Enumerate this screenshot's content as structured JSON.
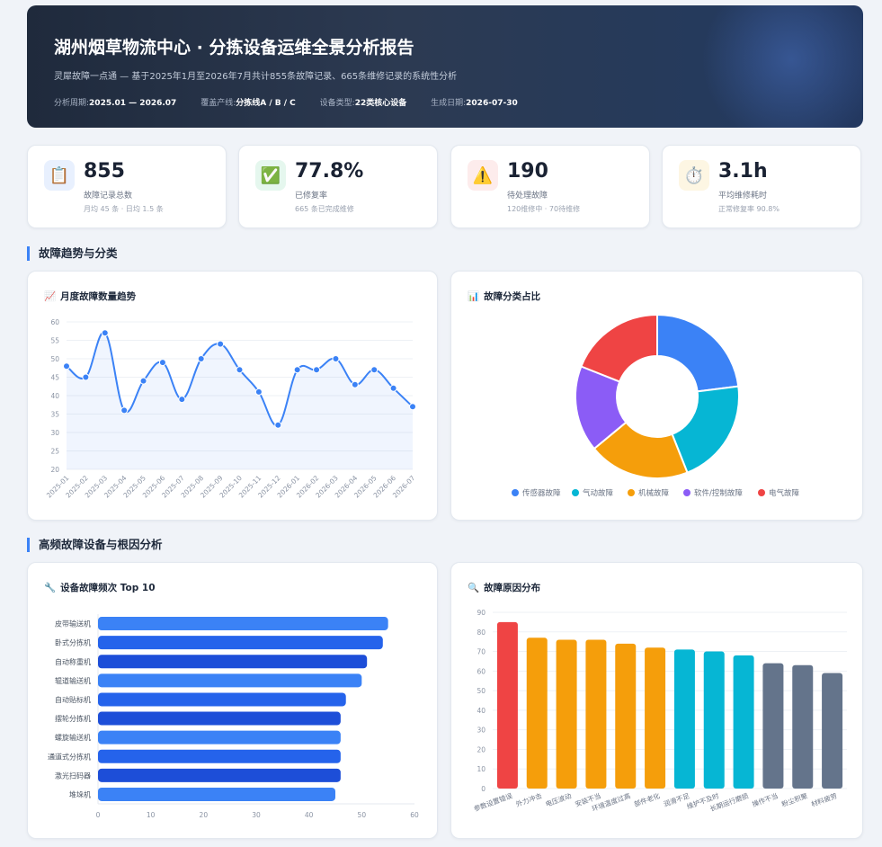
{
  "header": {
    "title": "湖州烟草物流中心 · 分拣设备运维全景分析报告",
    "subtitle": "灵犀故障一点通 — 基于2025年1月至2026年7月共计855条故障记录、665条维修记录的系统性分析",
    "meta": [
      {
        "label": "分析周期:",
        "value": "2025.01 — 2026.07"
      },
      {
        "label": "覆盖产线:",
        "value": "分拣线A / B / C"
      },
      {
        "label": "设备类型:",
        "value": "22类核心设备"
      },
      {
        "label": "生成日期:",
        "value": "2026-07-30"
      }
    ]
  },
  "kpis": [
    {
      "icon": "clipboard-icon",
      "glyph": "📋",
      "bg": "#e8f0fe",
      "value": "855",
      "label": "故障记录总数",
      "detail": "月均 45 条 · 日均 1.5 条"
    },
    {
      "icon": "check-icon",
      "glyph": "✅",
      "bg": "#e5f7ee",
      "value": "77.8%",
      "label": "已修复率",
      "detail": "665 条已完成维修"
    },
    {
      "icon": "warning-icon",
      "glyph": "⚠️",
      "bg": "#fdecec",
      "value": "190",
      "label": "待处理故障",
      "detail": "120维修中 · 70待维修"
    },
    {
      "icon": "stopwatch-icon",
      "glyph": "⏱️",
      "bg": "#fdf6e3",
      "value": "3.1h",
      "label": "平均维修耗时",
      "detail": "正常修复率 90.8%"
    }
  ],
  "sections": {
    "trend": "故障趋势与分类",
    "root": "高频故障设备与根因分析"
  },
  "cards": {
    "monthly": {
      "icon": "chart-up-icon",
      "glyph": "📈",
      "title": "月度故障数量趋势"
    },
    "category": {
      "icon": "bar-chart-icon",
      "glyph": "📊",
      "title": "故障分类占比"
    },
    "equipment": {
      "icon": "wrench-icon",
      "glyph": "🔧",
      "title": "设备故障频次 Top 10"
    },
    "cause": {
      "icon": "magnifier-icon",
      "glyph": "🔍",
      "title": "故障原因分布"
    }
  },
  "colors": {
    "blue": "#3b82f6",
    "cyan": "#06b6d4",
    "orange": "#f59e0b",
    "purple": "#8b5cf6",
    "red": "#ef4444",
    "slate": "#64748b",
    "navy": "#1d4ed8"
  },
  "chart_data": [
    {
      "id": "monthly",
      "type": "line",
      "x": [
        "2025-01",
        "2025-02",
        "2025-03",
        "2025-04",
        "2025-05",
        "2025-06",
        "2025-07",
        "2025-08",
        "2025-09",
        "2025-10",
        "2025-11",
        "2025-12",
        "2026-01",
        "2026-02",
        "2026-03",
        "2026-04",
        "2026-05",
        "2026-06",
        "2026-07"
      ],
      "values": [
        48,
        45,
        57,
        36,
        44,
        49,
        39,
        50,
        54,
        47,
        41,
        32,
        47,
        47,
        50,
        43,
        47,
        42,
        37
      ],
      "ylim": [
        20,
        60
      ],
      "yticks": [
        20,
        25,
        30,
        35,
        40,
        45,
        50,
        55,
        60
      ],
      "grid": true,
      "color": "#3b82f6"
    },
    {
      "id": "category",
      "type": "pie",
      "donut": true,
      "labels": [
        "传感器故障",
        "气动故障",
        "机械故障",
        "软件/控制故障",
        "电气故障"
      ],
      "values": [
        23,
        21,
        20,
        17,
        19
      ],
      "colors": [
        "#3b82f6",
        "#06b6d4",
        "#f59e0b",
        "#8b5cf6",
        "#ef4444"
      ],
      "legend": "bottom"
    },
    {
      "id": "equipment",
      "type": "bar",
      "orientation": "horizontal",
      "categories": [
        "皮带输送机",
        "卧式分拣机",
        "自动称重机",
        "辊道输送机",
        "自动贴标机",
        "摆轮分拣机",
        "螺旋输送机",
        "通道式分拣机",
        "激光扫码器",
        "堆垛机"
      ],
      "values": [
        55,
        54,
        51,
        50,
        47,
        46,
        46,
        46,
        46,
        45
      ],
      "colors": [
        "#3b82f6",
        "#2563eb",
        "#1d4ed8",
        "#3b82f6",
        "#2563eb",
        "#1d4ed8",
        "#3b82f6",
        "#2563eb",
        "#1d4ed8",
        "#3b82f6"
      ],
      "xlim": [
        0,
        60
      ],
      "xticks": [
        0,
        10,
        20,
        30,
        40,
        50,
        60
      ]
    },
    {
      "id": "cause",
      "type": "bar",
      "categories": [
        "参数设置错误",
        "外力冲击",
        "电压波动",
        "安装不当",
        "环境温度过高",
        "部件老化",
        "润滑不足",
        "维护不及时",
        "长期运行磨损",
        "操作不当",
        "粉尘积聚",
        "材料疲劳"
      ],
      "values": [
        85,
        77,
        76,
        76,
        74,
        72,
        71,
        70,
        68,
        64,
        63,
        59
      ],
      "colors": [
        "#ef4444",
        "#f59e0b",
        "#f59e0b",
        "#f59e0b",
        "#f59e0b",
        "#f59e0b",
        "#06b6d4",
        "#06b6d4",
        "#06b6d4",
        "#64748b",
        "#64748b",
        "#64748b"
      ],
      "ylim": [
        0,
        90
      ],
      "yticks": [
        0,
        10,
        20,
        30,
        40,
        50,
        60,
        70,
        80,
        90
      ]
    }
  ]
}
